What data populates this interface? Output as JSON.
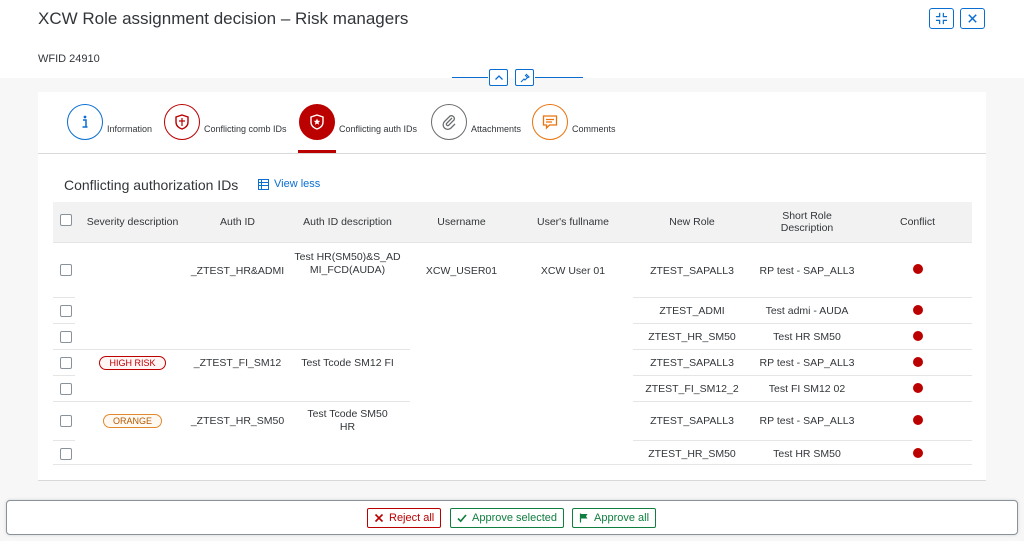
{
  "header": {
    "title": "XCW Role assignment decision – Risk managers",
    "wfid": "WFID 24910"
  },
  "tabs": [
    {
      "label": "Information",
      "icon": "info-icon",
      "color": "#0a6ed1"
    },
    {
      "label": "Conflicting comb IDs",
      "icon": "shield-icon",
      "color": "#bb0000"
    },
    {
      "label": "Conflicting auth IDs",
      "icon": "badge-icon",
      "color": "#bb0000"
    },
    {
      "label": "Attachments",
      "icon": "paperclip-icon",
      "color": "#6a6d70"
    },
    {
      "label": "Comments",
      "icon": "comment-icon",
      "color": "#e9730c"
    }
  ],
  "active_tab": "Conflicting auth IDs",
  "section": {
    "title": "Conflicting authorization IDs",
    "view_less": "View less"
  },
  "table": {
    "columns": [
      "Severity description",
      "Auth ID",
      "Auth ID description",
      "Username",
      "User's fullname",
      "New Role",
      "Short Role Description",
      "Conflict"
    ],
    "groups": [
      {
        "severity": "",
        "auth_id": "_ZTEST_HR&ADMI",
        "auth_desc": "Test HR(SM50)&S_ADMI_FCD(AUDA)",
        "rows": [
          {
            "new_role": "ZTEST_SAPALL3",
            "short_desc": "RP test - SAP_ALL3"
          },
          {
            "new_role": "ZTEST_ADMI",
            "short_desc": "Test admi - AUDA"
          },
          {
            "new_role": "ZTEST_HR_SM50",
            "short_desc": "Test HR SM50"
          }
        ]
      },
      {
        "severity": "HIGH RISK",
        "auth_id": "_ZTEST_FI_SM12",
        "auth_desc": "Test Tcode SM12 FI",
        "rows": [
          {
            "new_role": "ZTEST_SAPALL3",
            "short_desc": "RP test - SAP_ALL3"
          },
          {
            "new_role": "ZTEST_FI_SM12_2",
            "short_desc": "Test FI SM12 02"
          }
        ]
      },
      {
        "severity": "ORANGE",
        "auth_id": "_ZTEST_HR_SM50",
        "auth_desc": "Test Tcode SM50 HR",
        "rows": [
          {
            "new_role": "ZTEST_SAPALL3",
            "short_desc": "RP test - SAP_ALL3"
          },
          {
            "new_role": "ZTEST_HR_SM50",
            "short_desc": "Test HR SM50"
          }
        ]
      }
    ],
    "username": "XCW_USER01",
    "fullname": "XCW User 01",
    "conflict_color": "#bb0000"
  },
  "footer": {
    "reject_all": "Reject all",
    "approve_selected": "Approve selected",
    "approve_all": "Approve all"
  }
}
